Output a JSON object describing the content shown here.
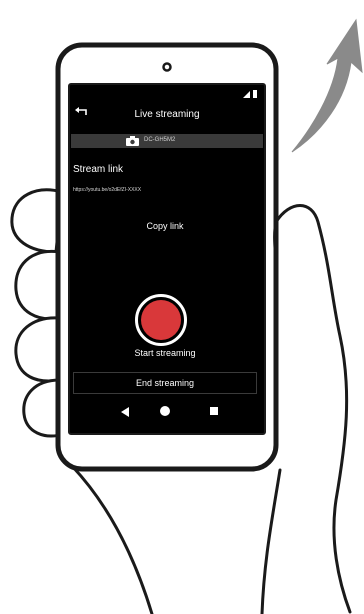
{
  "app": {
    "title": "Live streaming"
  },
  "camera": {
    "name": "DC-GH5M2",
    "icon": "camera-icon"
  },
  "stream_link": {
    "heading": "Stream link",
    "url": "https://youtu.be/o2dEfZI-XXXX",
    "copy_label": "Copy link"
  },
  "controls": {
    "start_label": "Start streaming",
    "end_label": "End streaming"
  },
  "icons": {
    "back": "back-arrow-icon",
    "nav_back": "triangle-back-icon",
    "nav_home": "circle-home-icon",
    "nav_recent": "square-recent-icon",
    "status": "signal-battery-icon",
    "direction": "curved-arrow-icon"
  },
  "colors": {
    "screen_background": "#000000",
    "camera_bar": "#3a3a3a",
    "record_button": "#d9383a",
    "arrow": "#8a8a8a"
  }
}
